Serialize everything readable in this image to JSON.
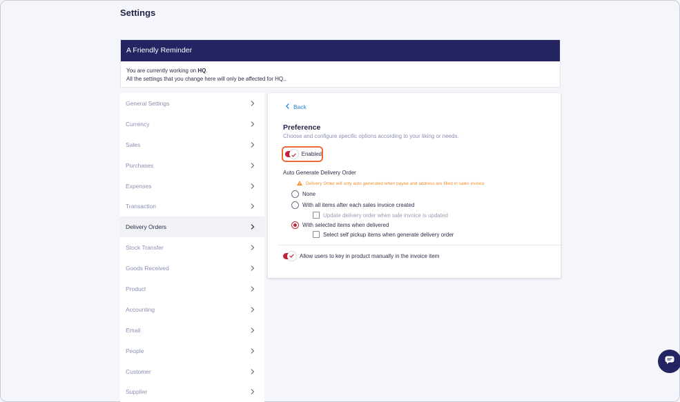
{
  "page": {
    "title": "Settings"
  },
  "reminder": {
    "heading": "A Friendly Reminder",
    "line1_prefix": "You are currently working on ",
    "branch": "HQ",
    "line1_suffix": ".",
    "line2": "All the settings that you change here will only be affected for HQ.."
  },
  "sidebar": {
    "items": [
      {
        "label": "General Settings"
      },
      {
        "label": "Currency"
      },
      {
        "label": "Sales"
      },
      {
        "label": "Purchases"
      },
      {
        "label": "Expenses"
      },
      {
        "label": "Transaction"
      },
      {
        "label": "Delivery Orders",
        "active": true
      },
      {
        "label": "Stock Transfer"
      },
      {
        "label": "Goods Received"
      },
      {
        "label": "Product"
      },
      {
        "label": "Accounting"
      },
      {
        "label": "Email"
      },
      {
        "label": "People"
      },
      {
        "label": "Customer"
      },
      {
        "label": "Supplier"
      }
    ]
  },
  "panel": {
    "back_label": "Back",
    "title": "Preference",
    "subtitle": "Choose and configure specific options according to your liking or needs.",
    "enabled_label": "Enabled",
    "enabled_on": true,
    "auto_title": "Auto Generate Delivery Order",
    "warning": "Delivery Order will only auto generated when payee and address are filled in sales invoice",
    "options": {
      "none": "None",
      "all_items": "With all items after each sales invoice created",
      "update_on_change": "Update delivery order when sale invoice is updated",
      "selected_items": "With selected items when delivered",
      "self_pickup": "Select self pickup items when generate delivery order"
    },
    "selected_option": "selected_items",
    "allow_manual_label": "Allow users to key in product manually in the invoice item",
    "allow_manual_on": true
  },
  "icons": {
    "chevron": "chevron-right-icon",
    "back": "chevron-left-icon",
    "warning": "warning-icon",
    "chat": "chat-icon"
  },
  "colors": {
    "header_navy": "#232461",
    "accent_red": "#c2253a",
    "highlight_orange": "#ea6a3a",
    "link_blue": "#2a7ed8",
    "warning_orange": "#ef8f2e"
  }
}
